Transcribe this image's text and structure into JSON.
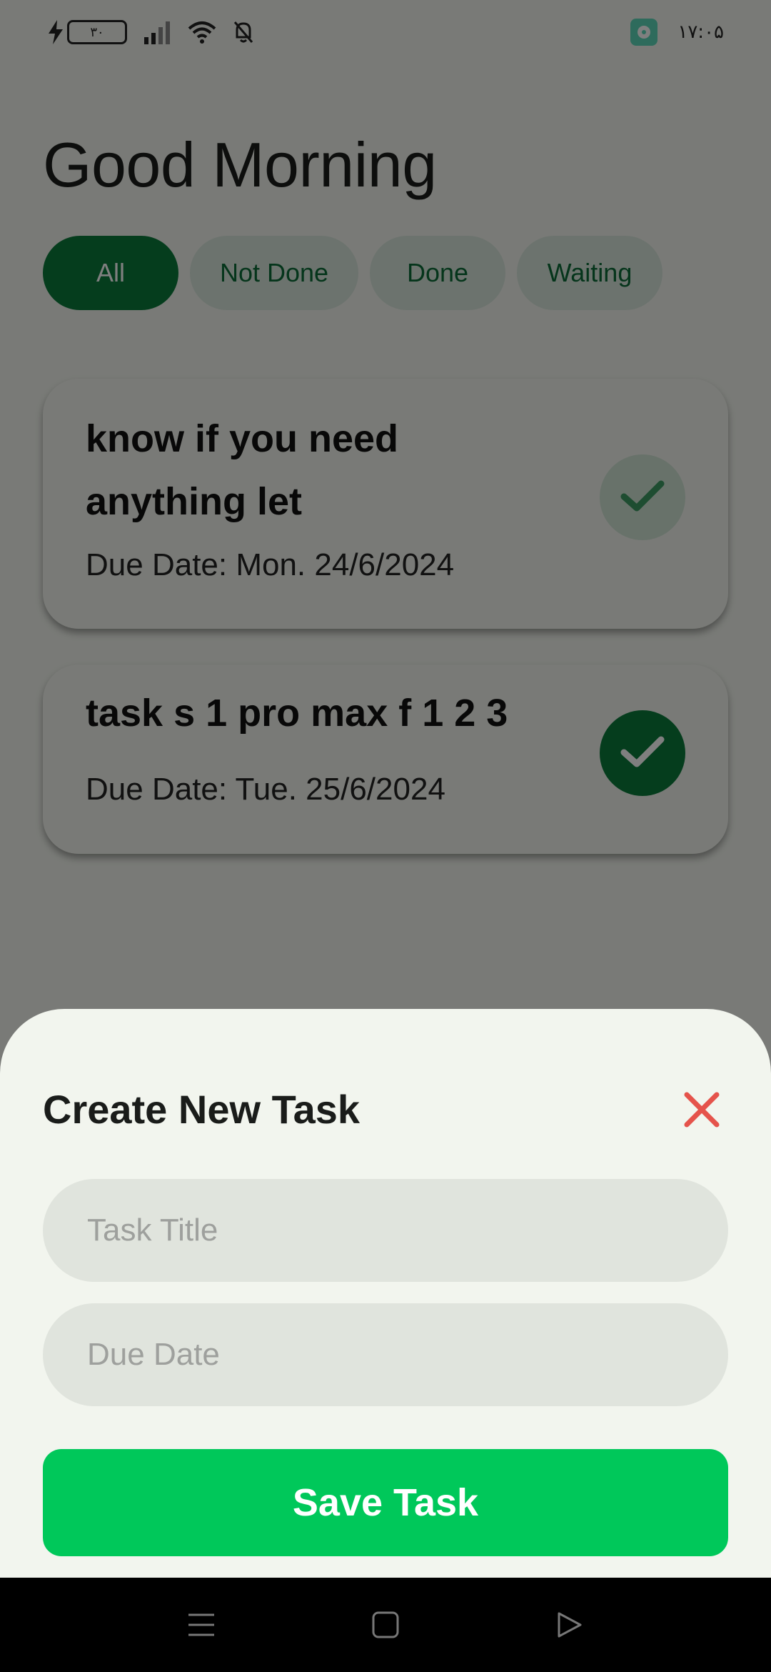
{
  "status_bar": {
    "battery_level": "۳۰",
    "time": "۱۷:۰۵"
  },
  "greeting": "Good Morning",
  "filters": [
    {
      "label": "All",
      "active": true
    },
    {
      "label": "Not Done",
      "active": false
    },
    {
      "label": "Done",
      "active": false
    },
    {
      "label": "Waiting",
      "active": false
    }
  ],
  "tasks": [
    {
      "title": "know if you need anything let",
      "due": "Due Date: Mon. 24/6/2024",
      "done": false
    },
    {
      "title": "task s 1 pro max f 1 2 3",
      "due": "Due Date: Tue. 25/6/2024",
      "done": true
    }
  ],
  "sheet": {
    "title": "Create New Task",
    "title_placeholder": "Task Title",
    "date_placeholder": "Due Date",
    "save_label": "Save Task"
  },
  "colors": {
    "primary": "#0a7a3b",
    "accent": "#00c85a",
    "close": "#e5534b",
    "background": "#f2f5ee"
  },
  "icons": {
    "close": "close-icon",
    "check": "check-icon",
    "nav_menu": "menu-icon",
    "nav_home": "home-icon",
    "nav_back": "back-icon"
  }
}
